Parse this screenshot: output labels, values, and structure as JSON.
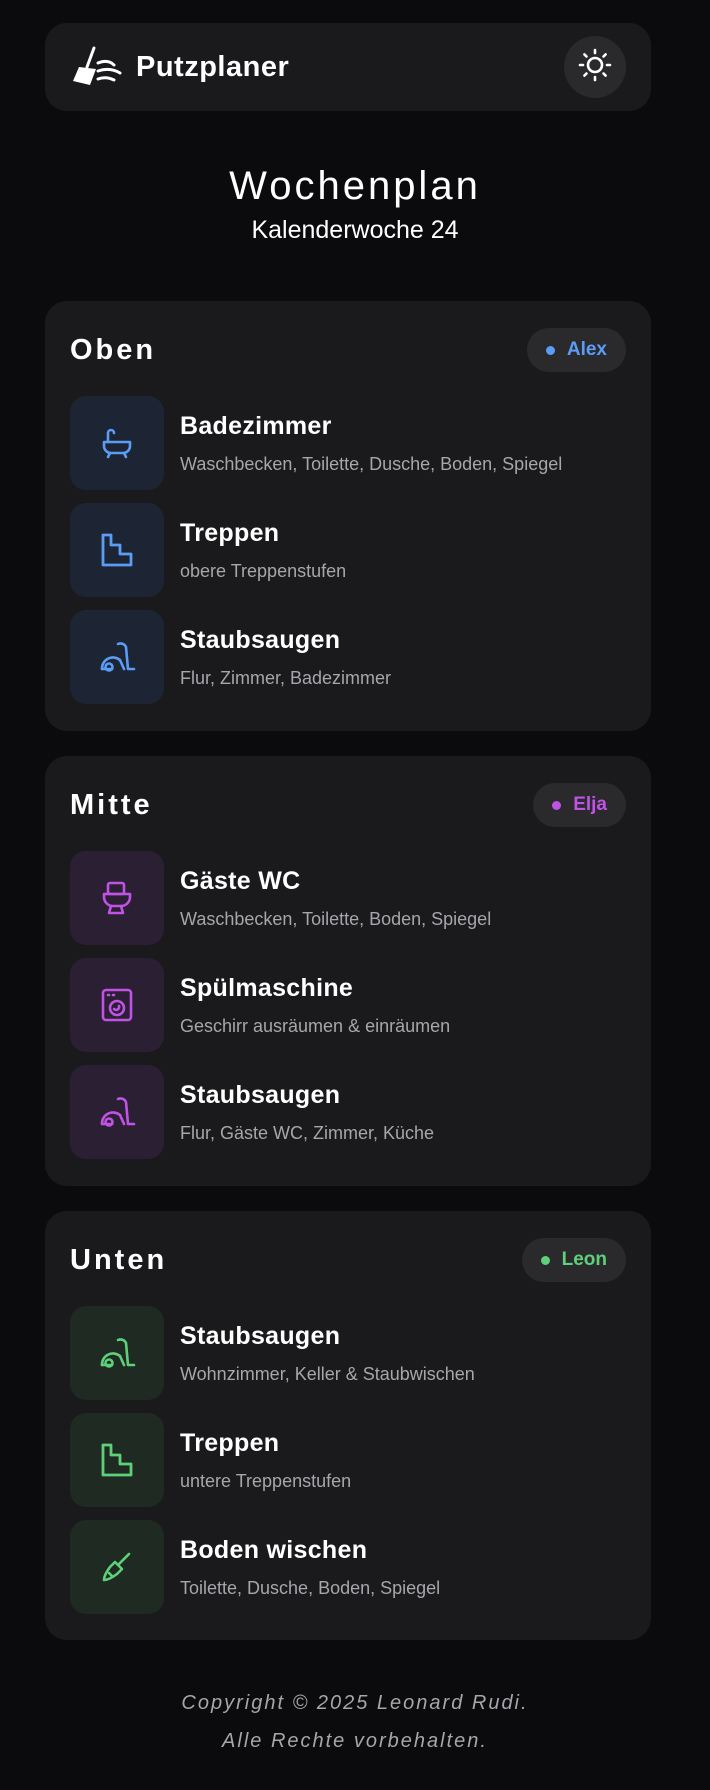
{
  "app": {
    "title": "Putzplaner"
  },
  "header": {
    "title": "Wochenplan",
    "subtitle": "Kalenderwoche 24"
  },
  "colors": {
    "blue": "#5b9cf5",
    "purple": "#c053e6",
    "green": "#5fd07a"
  },
  "sections": [
    {
      "title": "Oben",
      "person": "Alex",
      "tasks": [
        {
          "icon": "bathtub-icon",
          "title": "Badezimmer",
          "desc": "Waschbecken, Toilette, Dusche, Boden, Spiegel"
        },
        {
          "icon": "stairs-icon",
          "title": "Treppen",
          "desc": "obere Treppenstufen"
        },
        {
          "icon": "vacuum-icon",
          "title": "Staubsaugen",
          "desc": "Flur, Zimmer, Badezimmer"
        }
      ]
    },
    {
      "title": "Mitte",
      "person": "Elja",
      "tasks": [
        {
          "icon": "toilet-icon",
          "title": "Gäste WC",
          "desc": "Waschbecken, Toilette, Boden, Spiegel"
        },
        {
          "icon": "dishwasher-icon",
          "title": "Spülmaschine",
          "desc": "Geschirr ausräumen & einräumen"
        },
        {
          "icon": "vacuum-icon",
          "title": "Staubsaugen",
          "desc": "Flur, Gäste WC, Zimmer, Küche"
        }
      ]
    },
    {
      "title": "Unten",
      "person": "Leon",
      "tasks": [
        {
          "icon": "vacuum-icon",
          "title": "Staubsaugen",
          "desc": "Wohnzimmer, Keller & Staubwischen"
        },
        {
          "icon": "stairs-icon",
          "title": "Treppen",
          "desc": "untere Treppenstufen"
        },
        {
          "icon": "mop-icon",
          "title": "Boden wischen",
          "desc": "Toilette, Dusche, Boden, Spiegel"
        }
      ]
    }
  ],
  "footer": {
    "line1": "Copyright © 2025 Leonard Rudi.",
    "line2": "Alle Rechte vorbehalten."
  }
}
